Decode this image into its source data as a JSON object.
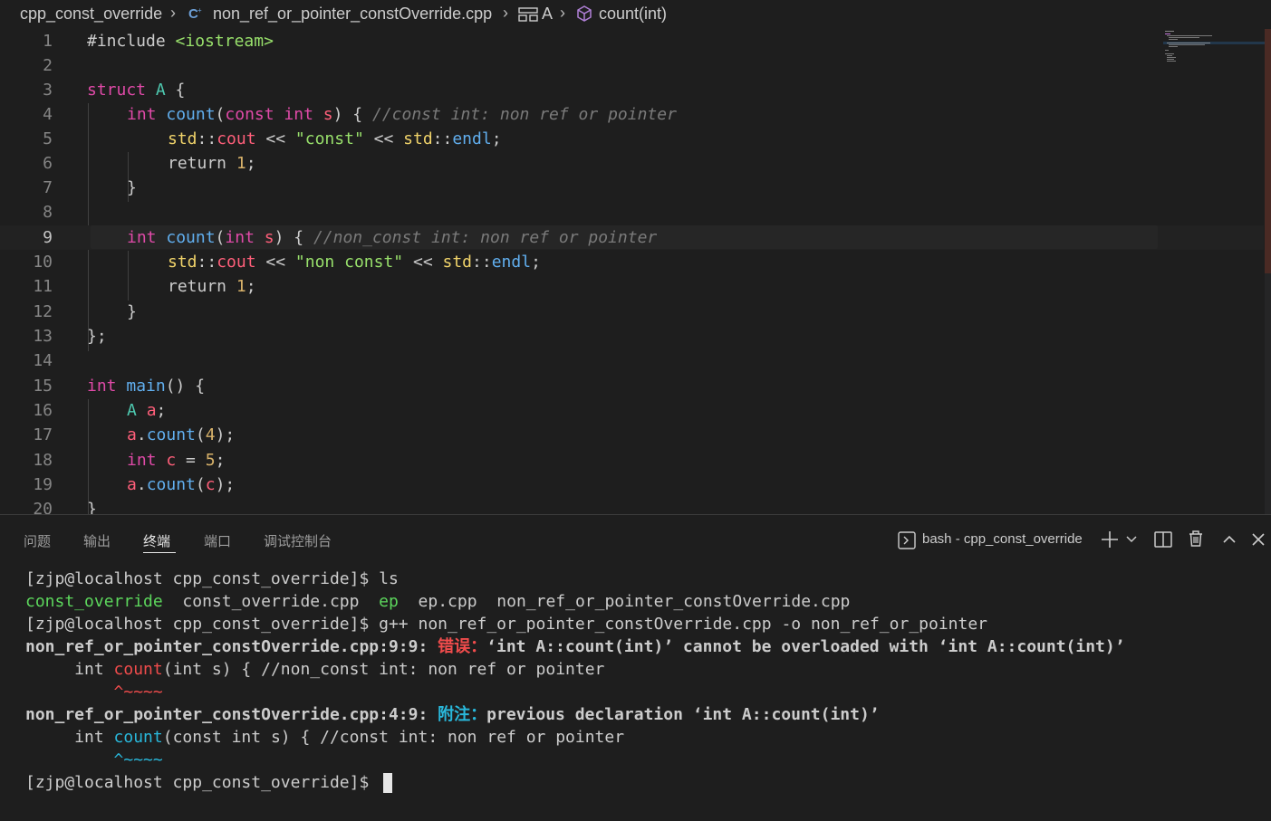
{
  "breadcrumb": {
    "folder": "cpp_const_override",
    "file": "non_ref_or_pointer_constOverride.cpp",
    "struct": "A",
    "method": "count(int)"
  },
  "editor": {
    "line_numbers": [
      "1",
      "2",
      "3",
      "4",
      "5",
      "6",
      "7",
      "8",
      "9",
      "10",
      "11",
      "12",
      "13",
      "14",
      "15",
      "16",
      "17",
      "18",
      "19",
      "20"
    ],
    "current_line": 9,
    "lines": {
      "l1_directive": "#include",
      "l1_header": "<iostream>",
      "l3_struct": "struct",
      "l3_name": "A",
      "l3_brace": " {",
      "l4_int": "int",
      "l4_fn": "count",
      "l4_open": "(",
      "l4_const": "const",
      "l4_int2": "int",
      "l4_param": "s",
      "l4_close": ") { ",
      "l4_comment": "//const int: non ref or pointer",
      "l5_std": "std",
      "l5_sep": "::",
      "l5_cout": "cout",
      "l5_op": " << ",
      "l5_str": "\"const\"",
      "l5_op2": " << ",
      "l5_std2": "std",
      "l5_sep2": "::",
      "l5_endl": "endl",
      "l5_semi": ";",
      "l6_return": "return",
      "l6_num": "1",
      "l6_semi": ";",
      "l7_brace": "}",
      "l9_int": "int",
      "l9_fn": "count",
      "l9_open": "(",
      "l9_int2": "int",
      "l9_param": "s",
      "l9_close": ") { ",
      "l9_comment": "//non_const int: non ref or pointer",
      "l10_std": "std",
      "l10_sep": "::",
      "l10_cout": "cout",
      "l10_op": " << ",
      "l10_str": "\"non const\"",
      "l10_op2": " << ",
      "l10_std2": "std",
      "l10_sep2": "::",
      "l10_endl": "endl",
      "l10_semi": ";",
      "l11_return": "return",
      "l11_num": "1",
      "l11_semi": ";",
      "l12_brace": "}",
      "l13_close": "};",
      "l15_int": "int",
      "l15_fn": "main",
      "l15_rest": "() {",
      "l16_type": "A",
      "l16_var": "a",
      "l16_semi": ";",
      "l17_var": "a",
      "l17_dot": ".",
      "l17_fn": "count",
      "l17_open": "(",
      "l17_num": "4",
      "l17_close": ");",
      "l18_int": "int",
      "l18_var": "c",
      "l18_eq": " = ",
      "l18_num": "5",
      "l18_semi": ";",
      "l19_var": "a",
      "l19_dot": ".",
      "l19_fn": "count",
      "l19_open": "(",
      "l19_arg": "c",
      "l19_close": ");",
      "l20_brace": "}"
    }
  },
  "panel": {
    "tabs": [
      "问题",
      "输出",
      "终端",
      "端口",
      "调试控制台"
    ],
    "active_tab": "终端",
    "terminal_name": "bash - cpp_const_override"
  },
  "terminal": {
    "prompt1": "[zjp@localhost cpp_const_override]$ ls",
    "ls_dir1": "const_override",
    "ls_file1": "const_override.cpp",
    "ls_dir2": "ep",
    "ls_file2": "ep.cpp",
    "ls_file3": "non_ref_or_pointer_constOverride.cpp",
    "prompt2": "[zjp@localhost cpp_const_override]$ g++ non_ref_or_pointer_constOverride.cpp -o non_ref_or_pointer",
    "err_loc": "non_ref_or_pointer_constOverride.cpp:9:9:",
    "err_label": "错误：",
    "err_msg": "‘int A::count(int)’ cannot be overloaded with ‘int A::count(int)’",
    "err_src_pre": "     int ",
    "err_src_hl": "count",
    "err_src_post": "(int s) { //non_const int: non ref or pointer",
    "err_caret": "         ^~~~~",
    "note_loc": "non_ref_or_pointer_constOverride.cpp:4:9:",
    "note_label": "附注：",
    "note_msg": "previous declaration ‘int A::count(int)’",
    "note_src_pre": "     int ",
    "note_src_hl": "count",
    "note_src_post": "(const int s) { //const int: non ref or pointer",
    "note_caret": "         ^~~~~",
    "prompt3": "[zjp@localhost cpp_const_override]$ "
  },
  "colors": {
    "editor_bg": "#1e1e1e",
    "keyword": "#e04aa8",
    "function": "#61afef",
    "string": "#98e06b",
    "number": "#d8b26a",
    "comment": "#7a7a7a",
    "terminal_error": "#f14c4c",
    "terminal_note": "#29b8db",
    "terminal_dir": "#5cd65c"
  }
}
